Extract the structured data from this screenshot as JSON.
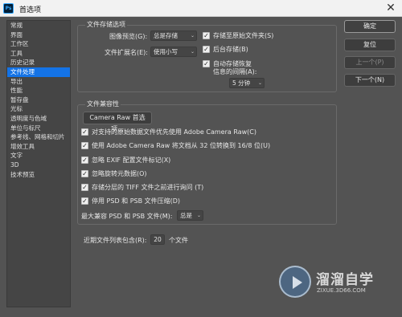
{
  "window": {
    "app_icon_text": "Ps",
    "title": "首选项",
    "close_glyph": "✕"
  },
  "nav": {
    "items": [
      {
        "label": "常规",
        "active": false
      },
      {
        "label": "界面",
        "active": false
      },
      {
        "label": "工作区",
        "active": false
      },
      {
        "label": "工具",
        "active": false
      },
      {
        "label": "历史记录",
        "active": false
      },
      {
        "label": "文件处理",
        "active": true
      },
      {
        "label": "导出",
        "active": false
      },
      {
        "label": "性能",
        "active": false
      },
      {
        "label": "暂存盘",
        "active": false
      },
      {
        "label": "光标",
        "active": false
      },
      {
        "label": "透明度与色域",
        "active": false
      },
      {
        "label": "单位与标尺",
        "active": false
      },
      {
        "label": "参考线、网格和切片",
        "active": false
      },
      {
        "label": "增效工具",
        "active": false
      },
      {
        "label": "文字",
        "active": false
      },
      {
        "label": "3D",
        "active": false
      },
      {
        "label": "技术预览",
        "active": false
      }
    ]
  },
  "file_save": {
    "title": "文件存储选项",
    "image_preview_label": "图像预览(G):",
    "image_preview_value": "总是存储",
    "extension_label": "文件扩展名(E):",
    "extension_value": "使用小写",
    "save_to_original": "存储至原始文件夹(S)",
    "background_save": "后台存储(B)",
    "auto_save_line1": "自动存储恢复",
    "auto_save_line2": "信息的间隔(A):",
    "interval_value": "5 分钟"
  },
  "compat": {
    "title": "文件兼容性",
    "camera_raw_button": "Camera Raw 首选项...",
    "options": [
      {
        "label": "对支持的原始数据文件优先使用 Adobe Camera Raw(C)",
        "checked": true
      },
      {
        "label": "使用 Adobe Camera Raw 将文档从 32 位转换到 16/8 位(U)",
        "checked": true
      },
      {
        "label": "忽略 EXIF 配置文件标记(X)",
        "checked": true
      },
      {
        "label": "忽略旋转元数据(O)",
        "checked": true
      },
      {
        "label": "存储分层的 TIFF 文件之前进行询问 (T)",
        "checked": true
      },
      {
        "label": "停用 PSD 和 PSB 文件压缩(D)",
        "checked": true
      }
    ],
    "maximize_label": "最大兼容 PSD 和 PSB 文件(M):",
    "maximize_value": "总是"
  },
  "recent": {
    "label": "近期文件列表包含(R):",
    "value": "20",
    "suffix": "个文件"
  },
  "buttons": {
    "ok": "确定",
    "reset": "复位",
    "prev": "上一个(P)",
    "next": "下一个(N)"
  },
  "watermark": {
    "title": "溜溜自学",
    "url": "ZIXUE.3D66.COM"
  },
  "colors": {
    "accent": "#1473e6",
    "background": "#535353"
  }
}
